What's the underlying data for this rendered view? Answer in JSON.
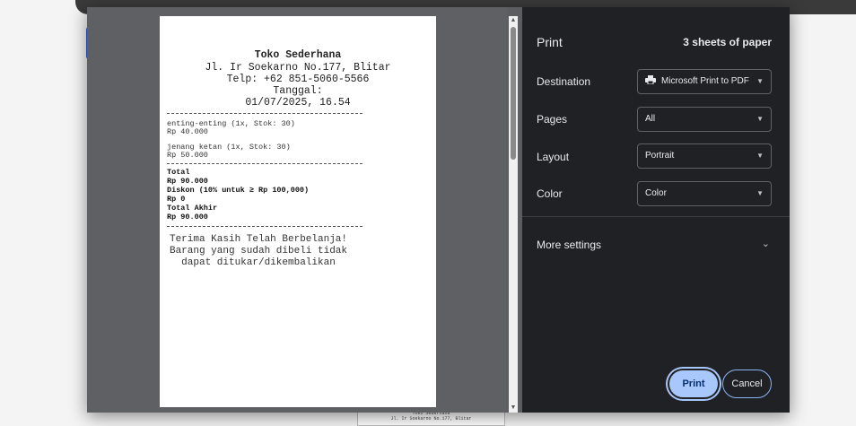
{
  "receipt": {
    "store_name": "Toko Sederhana",
    "address": "Jl. Ir Soekarno No.177, Blitar",
    "phone": "Telp: +62 851-5060-5566",
    "date_label": "Tanggal:",
    "date_value": "01/07/2025, 16.54",
    "items": [
      {
        "name": "enting-enting (1x, Stok: 30)",
        "price": "Rp 40.000"
      },
      {
        "name": "jenang ketan (1x, Stok: 30)",
        "price": "Rp 50.000"
      }
    ],
    "total_label": "Total",
    "total_value": "Rp 90.000",
    "discount_label": "Diskon (10% untuk ≥ Rp 100,000)",
    "discount_value": "Rp 0",
    "final_label": "Total Akhir",
    "final_value": "Rp 90.000",
    "thanks": "Terima Kasih Telah Berbelanja!",
    "note_line1": "Barang yang sudah dibeli tidak",
    "note_line2": "dapat ditukar/dikembalikan"
  },
  "background_receipt": {
    "store_name": "Toko Sederhana",
    "address": "Jl. Ir Soekarno No.177, Blitar"
  },
  "print_panel": {
    "title": "Print",
    "sheets": "3 sheets of paper",
    "destination_label": "Destination",
    "destination_value": "Microsoft Print to PDF",
    "pages_label": "Pages",
    "pages_value": "All",
    "layout_label": "Layout",
    "layout_value": "Portrait",
    "color_label": "Color",
    "color_value": "Color",
    "more_settings": "More settings",
    "print_button": "Print",
    "cancel_button": "Cancel"
  },
  "colors": {
    "panel_bg": "#202124",
    "accent": "#a8c7fa",
    "preview_bg": "#5e6064"
  }
}
